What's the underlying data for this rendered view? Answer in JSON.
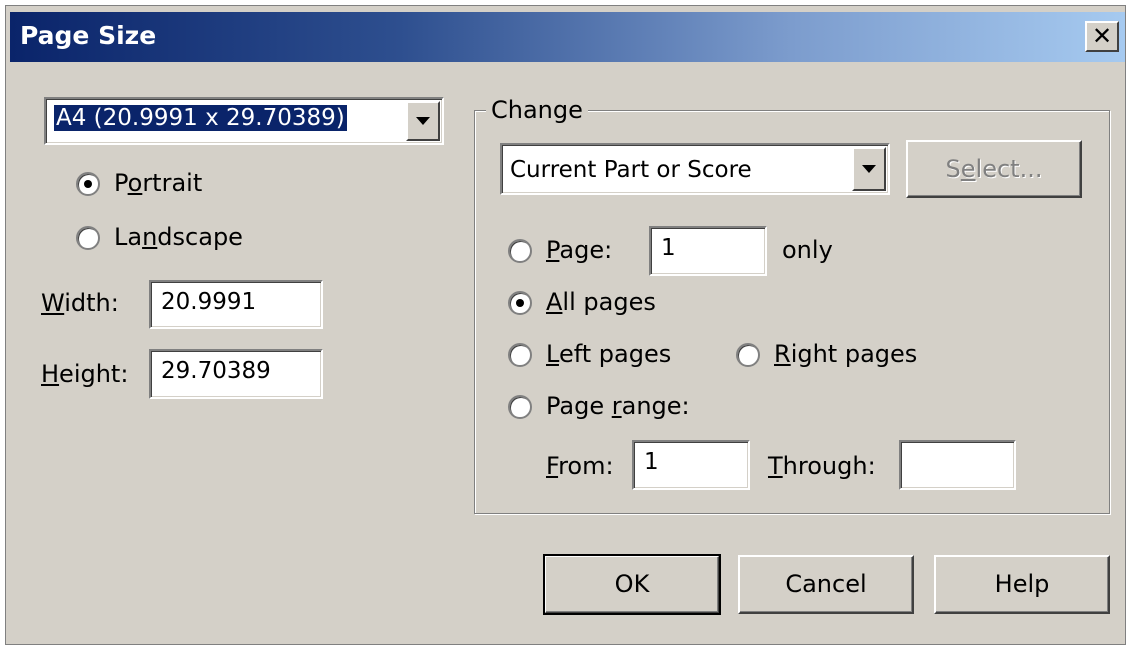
{
  "window": {
    "title": "Page Size",
    "close_glyph": "✕"
  },
  "paper": {
    "selected_size": "A4 (20.9991 x 29.70389)",
    "orientation": [
      {
        "label_pre": "P",
        "label_u": "o",
        "label_post": "rtrait",
        "checked": true
      },
      {
        "label_pre": "La",
        "label_u": "n",
        "label_post": "dscape",
        "checked": false
      }
    ],
    "width": {
      "label_u": "W",
      "label_post": "idth:",
      "value": "20.9991"
    },
    "height": {
      "label_u": "H",
      "label_post": "eight:",
      "value": "29.70389"
    }
  },
  "change": {
    "title": "Change",
    "scope_value": "Current Part or Score",
    "select_button": {
      "pre": "S",
      "u": "e",
      "post": "lect..."
    },
    "page_option": {
      "u": "P",
      "post": "age:",
      "value": "1",
      "suffix": "only",
      "checked": false
    },
    "all_pages": {
      "u": "A",
      "post": "ll pages",
      "checked": true
    },
    "left_pages": {
      "u": "L",
      "post": "eft pages",
      "checked": false
    },
    "right_pages": {
      "u": "R",
      "post": "ight pages",
      "checked": false
    },
    "page_range": {
      "pre": "Page ",
      "u": "r",
      "post": "ange:",
      "checked": false
    },
    "from": {
      "u": "F",
      "post": "rom:",
      "value": "1"
    },
    "through": {
      "u": "T",
      "post": "hrough:",
      "value": ""
    }
  },
  "buttons": {
    "ok": "OK",
    "cancel": "Cancel",
    "help": "Help"
  }
}
